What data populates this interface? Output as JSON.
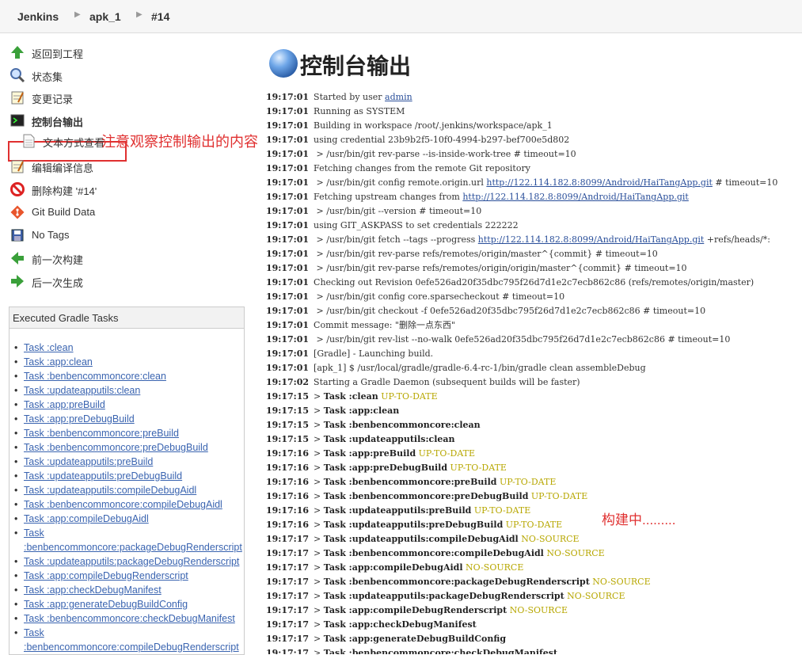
{
  "breadcrumbs": [
    "Jenkins",
    "apk_1",
    "#14"
  ],
  "side_tasks": [
    {
      "label": "返回到工程",
      "icon": "up-arrow-icon"
    },
    {
      "label": "状态集",
      "icon": "magnifier-icon"
    },
    {
      "label": "变更记录",
      "icon": "notepad-icon"
    },
    {
      "label": "控制台输出",
      "icon": "terminal-icon"
    },
    {
      "label": "文本方式查看",
      "icon": "document-icon"
    },
    {
      "label": "编辑编译信息",
      "icon": "notepad-icon"
    },
    {
      "label": "删除构建 '#14'",
      "icon": "no-entry-icon"
    },
    {
      "label": "Git Build Data",
      "icon": "git-icon"
    },
    {
      "label": "No Tags",
      "icon": "save-icon"
    },
    {
      "label": "前一次构建",
      "icon": "left-arrow-icon"
    },
    {
      "label": "后一次生成",
      "icon": "right-arrow-icon"
    }
  ],
  "annotations": {
    "left": "注意观察控制输出的内容",
    "right": "构建中........."
  },
  "gradle": {
    "title": "Executed Gradle Tasks",
    "tasks": [
      "Task :clean",
      "Task :app:clean",
      "Task :benbencommoncore:clean",
      "Task :updateapputils:clean",
      "Task :app:preBuild",
      "Task :app:preDebugBuild",
      "Task :benbencommoncore:preBuild",
      "Task :benbencommoncore:preDebugBuild",
      "Task :updateapputils:preBuild",
      "Task :updateapputils:preDebugBuild",
      "Task :updateapputils:compileDebugAidl",
      "Task :benbencommoncore:compileDebugAidl",
      "Task :app:compileDebugAidl",
      "Task :benbencommoncore:packageDebugRenderscript",
      "Task :updateapputils:packageDebugRenderscript",
      "Task :app:compileDebugRenderscript",
      "Task :app:checkDebugManifest",
      "Task :app:generateDebugBuildConfig",
      "Task :benbencommoncore:checkDebugManifest",
      "Task :benbencommoncore:compileDebugRenderscript"
    ]
  },
  "main": {
    "title": "控制台输出"
  },
  "console": [
    {
      "t": "19:17:01",
      "pre": "Started by user ",
      "link": "admin"
    },
    {
      "t": "19:17:01",
      "pre": "Running as SYSTEM"
    },
    {
      "t": "19:17:01",
      "pre": "Building in workspace /root/.jenkins/workspace/apk_1"
    },
    {
      "t": "19:17:01",
      "pre": "using credential 23b9b2f5-10f0-4994-b297-bef700e5d802"
    },
    {
      "t": "19:17:01",
      "pre": " > /usr/bin/git rev-parse --is-inside-work-tree # timeout=10"
    },
    {
      "t": "19:17:01",
      "pre": "Fetching changes from the remote Git repository"
    },
    {
      "t": "19:17:01",
      "pre": " > /usr/bin/git config remote.origin.url ",
      "link": "http://122.114.182.8:8099/Android/HaiTangApp.git",
      "post": " # timeout=10"
    },
    {
      "t": "19:17:01",
      "pre": "Fetching upstream changes from ",
      "link": "http://122.114.182.8:8099/Android/HaiTangApp.git"
    },
    {
      "t": "19:17:01",
      "pre": " > /usr/bin/git --version # timeout=10"
    },
    {
      "t": "19:17:01",
      "pre": "using GIT_ASKPASS to set credentials 222222"
    },
    {
      "t": "19:17:01",
      "pre": " > /usr/bin/git fetch --tags --progress ",
      "link": "http://122.114.182.8:8099/Android/HaiTangApp.git",
      "post": " +refs/heads/*:"
    },
    {
      "t": "19:17:01",
      "pre": " > /usr/bin/git rev-parse refs/remotes/origin/master^{commit} # timeout=10"
    },
    {
      "t": "19:17:01",
      "pre": " > /usr/bin/git rev-parse refs/remotes/origin/origin/master^{commit} # timeout=10"
    },
    {
      "t": "19:17:01",
      "pre": "Checking out Revision 0efe526ad20f35dbc795f26d7d1e2c7ecb862c86 (refs/remotes/origin/master)"
    },
    {
      "t": "19:17:01",
      "pre": " > /usr/bin/git config core.sparsecheckout # timeout=10"
    },
    {
      "t": "19:17:01",
      "pre": " > /usr/bin/git checkout -f 0efe526ad20f35dbc795f26d7d1e2c7ecb862c86 # timeout=10"
    },
    {
      "t": "19:17:01",
      "pre": "Commit message: \"删除一点东西\""
    },
    {
      "t": "19:17:01",
      "pre": " > /usr/bin/git rev-list --no-walk 0efe526ad20f35dbc795f26d7d1e2c7ecb862c86 # timeout=10"
    },
    {
      "t": "19:17:01",
      "pre": "[Gradle] - Launching build."
    },
    {
      "t": "19:17:01",
      "pre": "[apk_1] $ /usr/local/gradle/gradle-6.4-rc-1/bin/gradle clean assembleDebug"
    },
    {
      "t": "19:17:02",
      "pre": "Starting a Gradle Daemon (subsequent builds will be faster)"
    },
    {
      "t": "19:17:15",
      "pre": "> ",
      "task": "Task :clean",
      "status": "UP-TO-DATE"
    },
    {
      "t": "19:17:15",
      "pre": "> ",
      "task": "Task :app:clean"
    },
    {
      "t": "19:17:15",
      "pre": "> ",
      "task": "Task :benbencommoncore:clean"
    },
    {
      "t": "19:17:15",
      "pre": "> ",
      "task": "Task :updateapputils:clean"
    },
    {
      "t": "19:17:16",
      "pre": "> ",
      "task": "Task :app:preBuild",
      "status": "UP-TO-DATE"
    },
    {
      "t": "19:17:16",
      "pre": "> ",
      "task": "Task :app:preDebugBuild",
      "status": "UP-TO-DATE"
    },
    {
      "t": "19:17:16",
      "pre": "> ",
      "task": "Task :benbencommoncore:preBuild",
      "status": "UP-TO-DATE"
    },
    {
      "t": "19:17:16",
      "pre": "> ",
      "task": "Task :benbencommoncore:preDebugBuild",
      "status": "UP-TO-DATE"
    },
    {
      "t": "19:17:16",
      "pre": "> ",
      "task": "Task :updateapputils:preBuild",
      "status": "UP-TO-DATE"
    },
    {
      "t": "19:17:16",
      "pre": "> ",
      "task": "Task :updateapputils:preDebugBuild",
      "status": "UP-TO-DATE"
    },
    {
      "t": "19:17:17",
      "pre": "> ",
      "task": "Task :updateapputils:compileDebugAidl",
      "status": "NO-SOURCE"
    },
    {
      "t": "19:17:17",
      "pre": "> ",
      "task": "Task :benbencommoncore:compileDebugAidl",
      "status": "NO-SOURCE"
    },
    {
      "t": "19:17:17",
      "pre": "> ",
      "task": "Task :app:compileDebugAidl",
      "status": "NO-SOURCE"
    },
    {
      "t": "19:17:17",
      "pre": "> ",
      "task": "Task :benbencommoncore:packageDebugRenderscript",
      "status": "NO-SOURCE"
    },
    {
      "t": "19:17:17",
      "pre": "> ",
      "task": "Task :updateapputils:packageDebugRenderscript",
      "status": "NO-SOURCE"
    },
    {
      "t": "19:17:17",
      "pre": "> ",
      "task": "Task :app:compileDebugRenderscript",
      "status": "NO-SOURCE"
    },
    {
      "t": "19:17:17",
      "pre": "> ",
      "task": "Task :app:checkDebugManifest"
    },
    {
      "t": "19:17:17",
      "pre": "> ",
      "task": "Task :app:generateDebugBuildConfig"
    },
    {
      "t": "19:17:17",
      "pre": "> ",
      "task": "Task :benbencommoncore:checkDebugManifest"
    }
  ],
  "colors": {
    "annotation": "#e03030",
    "link": "#2a4f9a",
    "status": "#b7a700"
  }
}
